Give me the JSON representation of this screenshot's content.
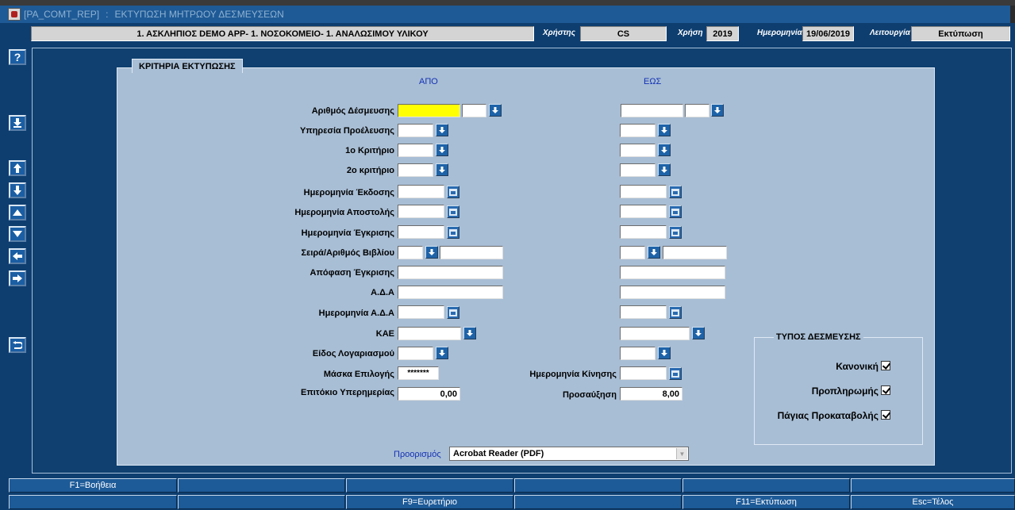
{
  "window": {
    "form_code": "[PA_COMT_REP]",
    "separator": ":",
    "title": "ΕΚΤΥΠΩΣΗ ΜΗΤΡΩΟΥ ΔΕΣΜΕΥΣΕΩΝ"
  },
  "info": {
    "entity": "1. ΑΣΚΛΗΠΙΟΣ DEMO APP- 1. ΝΟΣΟΚΟΜΕΙΟ- 1. ΑΝΑΛΩΣΙΜΟΥ ΥΛΙΚΟΥ",
    "user_label": "Χρήστης",
    "user_value": "CS",
    "year_label": "Χρήση",
    "year_value": "2019",
    "date_label": "Ημερομηνία",
    "date_value": "19/06/2019",
    "mode_label": "Λειτουργία",
    "mode_value": "Εκτύπωση"
  },
  "sidebar": {
    "help_label": "?"
  },
  "criteria": {
    "title": "ΚΡΙΤΗΡΙΑ ΕΚΤΥΠΩΣΗΣ",
    "from_header": "ΑΠΟ",
    "to_header": "ΕΩΣ",
    "fields": {
      "commitment_no": "Αριθμός Δέσμευσης",
      "origin_service": "Υπηρεσία Προέλευσης",
      "criterion1": "1ο Κριτήριο",
      "criterion2": "2ο κριτήριο",
      "issue_date": "Ημερομηνία Έκδοσης",
      "dispatch_date": "Ημερομηνία Αποστολής",
      "approval_date": "Ημερομηνία Έγκρισης",
      "book_series": "Σειρά/Αριθμός Βιβλίου",
      "approval_decision": "Απόφαση Έγκρισης",
      "ada": "Α.Δ.Α",
      "ada_date": "Ημερομηνία Α.Δ.Α",
      "kae": "ΚΑΕ",
      "account_type": "Είδος Λογαριασμού",
      "selection_mask": "Μάσκα Επιλογής",
      "late_interest": "Επιτόκιο Υπερημερίας",
      "movement_date": "Ημερομηνία Κίνησης",
      "surcharge": "Προσαύξηση"
    },
    "values": {
      "selection_mask": "*******",
      "late_interest": "0,00",
      "surcharge": "8,00"
    }
  },
  "commitment_type": {
    "title": "ΤΥΠΟΣ ΔΕΣΜΕΥΣΗΣ",
    "options": [
      {
        "label": "Κανονική",
        "checked": true
      },
      {
        "label": "Προπληρωμής",
        "checked": true
      },
      {
        "label": "Πάγιας Προκαταβολής",
        "checked": true
      }
    ]
  },
  "destination": {
    "label": "Προορισμός",
    "value": "Acrobat Reader (PDF)"
  },
  "function_keys": {
    "row1": [
      "F1=Βοήθεια",
      "",
      "",
      "",
      "",
      ""
    ],
    "row2": [
      "",
      "",
      "F9=Ευρετήριο",
      "",
      "F11=Εκτύπωση",
      "Esc=Τέλος"
    ]
  },
  "colors": {
    "background": "#0e3e70",
    "panel": "#a8bed5",
    "required_field": "#ffff00",
    "header_blue": "#1432b4"
  }
}
